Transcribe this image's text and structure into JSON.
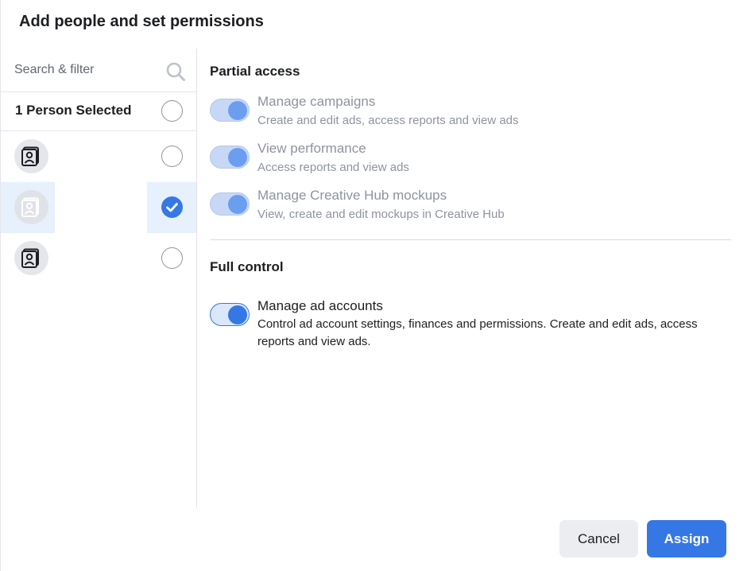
{
  "dialog": {
    "title": "Add people and set permissions"
  },
  "people_panel": {
    "search_placeholder": "Search & filter",
    "selected_label": "1 Person Selected",
    "people": [
      {
        "avatar_icon": "person-badge-icon",
        "selected": false
      },
      {
        "avatar_icon": "person-badge-icon",
        "selected": true
      },
      {
        "avatar_icon": "person-badge-icon",
        "selected": false
      }
    ]
  },
  "permissions": {
    "partial_access_heading": "Partial access",
    "partial": [
      {
        "title": "Manage campaigns",
        "description": "Create and edit ads, access reports and view ads",
        "enabled": true
      },
      {
        "title": "View performance",
        "description": "Access reports and view ads",
        "enabled": true
      },
      {
        "title": "Manage Creative Hub mockups",
        "description": "View, create and edit mockups in Creative Hub",
        "enabled": true
      }
    ],
    "full_control_heading": "Full control",
    "full": [
      {
        "title": "Manage ad accounts",
        "description": "Control ad account settings, finances and permissions. Create and edit ads, access reports and view ads.",
        "enabled": true
      }
    ]
  },
  "footer": {
    "cancel_label": "Cancel",
    "assign_label": "Assign"
  },
  "colors": {
    "accent": "#3578e5",
    "highlight": "#e7f0fd"
  }
}
